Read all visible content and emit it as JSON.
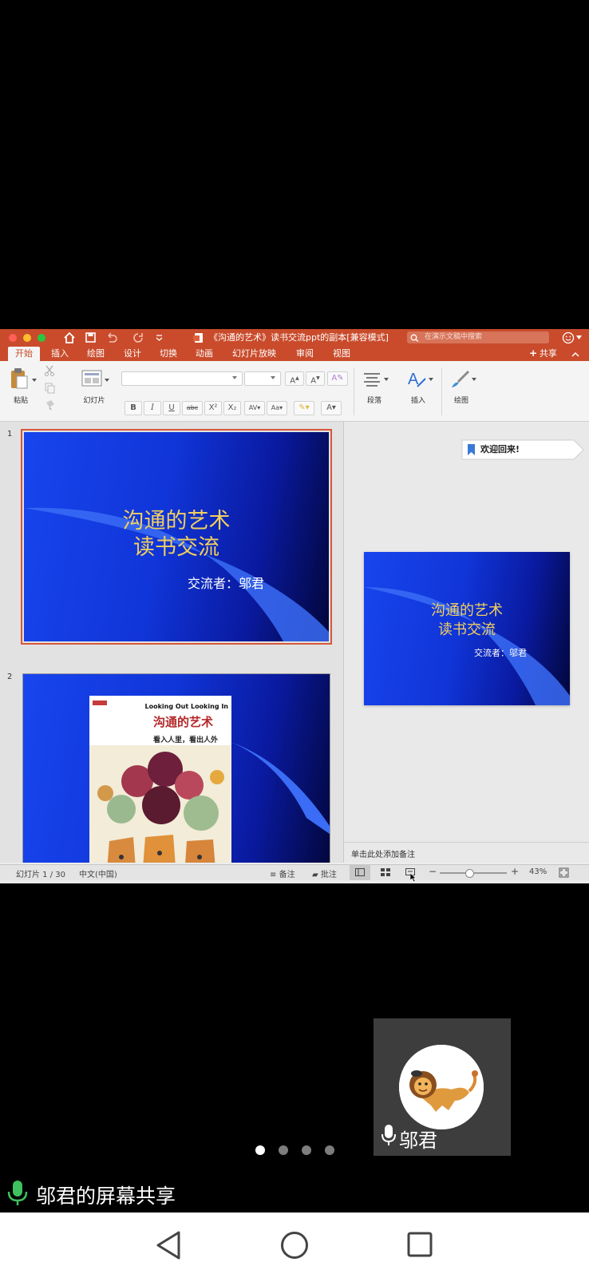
{
  "window": {
    "title": "《沟通的艺术》读书交流ppt的副本[兼容模式]",
    "search_placeholder": "在演示文稿中搜索",
    "share_label": "共享"
  },
  "tabs": [
    "开始",
    "插入",
    "绘图",
    "设计",
    "切换",
    "动画",
    "幻灯片放映",
    "审阅",
    "视图"
  ],
  "ribbon": {
    "paste": "粘贴",
    "slides": "幻灯片",
    "paragraph": "段落",
    "insert": "插入",
    "draw": "绘图",
    "format_buttons": [
      "B",
      "I",
      "U",
      "abc",
      "X²",
      "X₂"
    ]
  },
  "slides": [
    {
      "number": "1",
      "title_line1": "沟通的艺术",
      "title_line2": "读书交流",
      "subtitle": "交流者：邬君"
    },
    {
      "number": "2",
      "book_header": "Looking Out Looking In",
      "book_title": "沟通的艺术",
      "book_subtitle": "看入人里，看出人外"
    }
  ],
  "welcome_tooltip": "欢迎回来!",
  "notes_placeholder": "单击此处添加备注",
  "status": {
    "slide_counter": "幻灯片 1 / 30",
    "language": "中文(中国)",
    "notes_label": "备注",
    "comments_label": "批注",
    "zoom": "43%",
    "zoom_fraction": 0.43
  },
  "participant_name": "邬君",
  "screen_share_label": "邬君的屏幕共享",
  "page_indicator": {
    "count": 4,
    "active": 0
  },
  "colors": {
    "ppt_accent": "#c94b2b",
    "slide_title": "#f1cf5e",
    "mic_green": "#3ec15e"
  }
}
